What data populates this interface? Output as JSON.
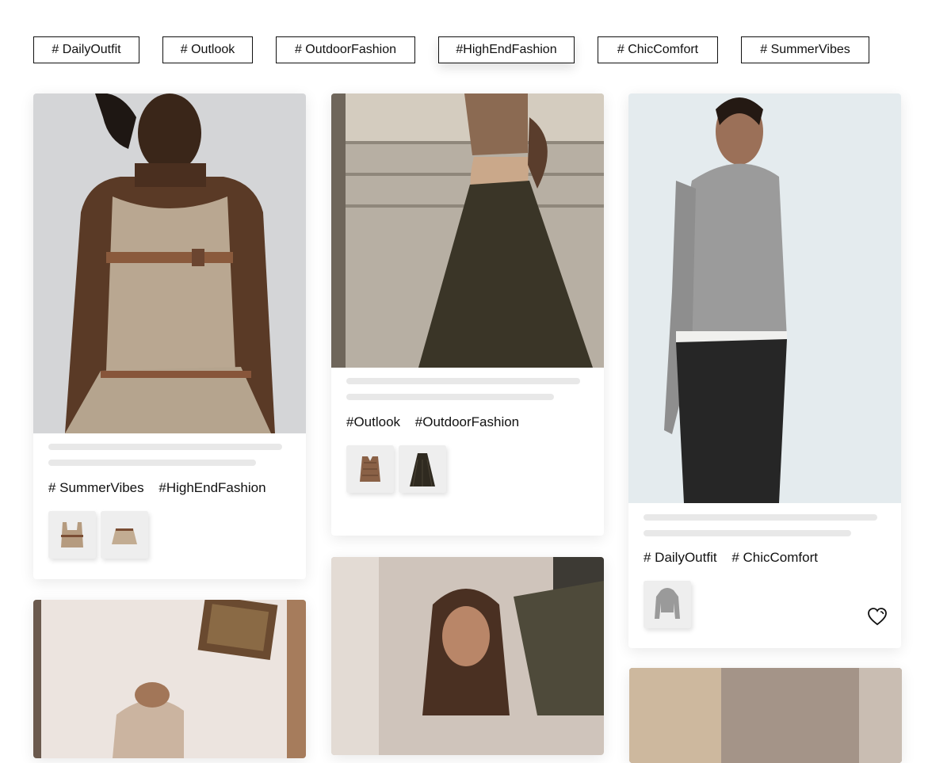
{
  "filter_tags": [
    {
      "label": "# DailyOutfit"
    },
    {
      "label": "# Outlook"
    },
    {
      "label": "# OutdoorFashion"
    },
    {
      "label": "#HighEndFashion",
      "active": true
    },
    {
      "label": "# ChicComfort"
    },
    {
      "label": "# SummerVibes"
    }
  ],
  "cards": [
    {
      "tags": [
        "# SummerVibes",
        "#HighEndFashion"
      ],
      "products": [
        "tank-top-thumb",
        "pleated-skirt-thumb"
      ]
    },
    {
      "tags": [
        "#Outlook",
        "#OutdoorFashion"
      ],
      "products": [
        "knit-vest-thumb",
        "maxi-skirt-thumb"
      ]
    },
    {
      "tags": [
        "# DailyOutfit",
        "# ChicComfort"
      ],
      "products": [
        "grey-knit-hoodie-thumb"
      ],
      "icon": "heart-icon"
    }
  ],
  "colors": {
    "border": "#111111",
    "skeleton": "#e8e8e8",
    "card_shadow": "rgba(0,0,0,0.09)"
  }
}
